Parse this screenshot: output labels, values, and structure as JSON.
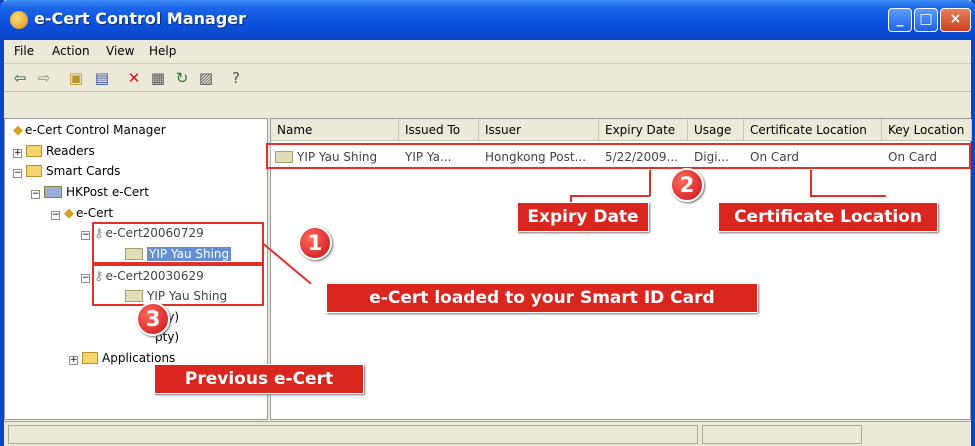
{
  "window": {
    "title": "e-Cert Control Manager",
    "icon": "ecert-icon",
    "buttons": [
      "_",
      "□",
      "×"
    ]
  },
  "menu": {
    "items": [
      "File",
      "Action",
      "View",
      "Help"
    ]
  },
  "toolbar": {
    "buttons": [
      "back-icon",
      "forward-icon",
      "up-folder-icon",
      "show-tree-icon",
      "delete-icon",
      "properties-icon",
      "refresh-icon",
      "export-icon",
      "help-icon"
    ]
  },
  "tree": {
    "root": "e-Cert Control Manager",
    "readers": "Readers",
    "smart_cards": "Smart Cards",
    "hkpost": "HKPost e-Cert",
    "ecert": "e-Cert",
    "cert1": "e-Cert20060729",
    "cert1_child": "YIP Yau Shing",
    "cert2": "e-Cert20030629",
    "cert2_child": "YIP Yau Shing",
    "empty1": "pty)",
    "empty2": "pty)",
    "applications": "Applications"
  },
  "list": {
    "columns": [
      "Name",
      "Issued To",
      "Issuer",
      "Expiry Date",
      "Usage",
      "Certificate Location",
      "Key Location"
    ],
    "rows": [
      {
        "name": "YIP Yau Shing",
        "issued_to": "YIP Ya...",
        "issuer": "Hongkong Post...",
        "expiry": "5/22/2009...",
        "usage": "Digi...",
        "cert_location": "On Card",
        "key_location": "On Card"
      }
    ]
  },
  "annotations": {
    "marker1": "1",
    "marker2": "2",
    "marker3": "3",
    "expiry_date": "Expiry Date",
    "certificate_location": "Certificate Location",
    "ecert_loaded": "e-Cert loaded to your Smart ID Card",
    "previous_ecert": "Previous e-Cert",
    "accent": "#d9261e"
  }
}
